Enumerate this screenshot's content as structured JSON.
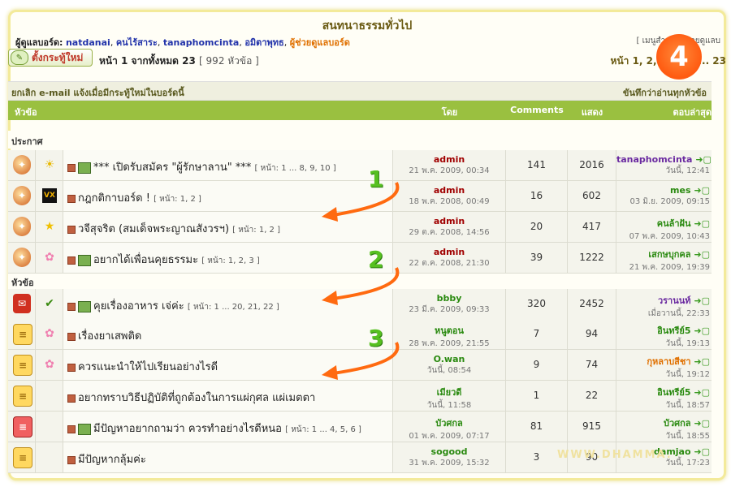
{
  "board": {
    "title": "สนทนาธรรมทั่วไป",
    "moderators_label": "ผู้ดูแลบอร์ด:",
    "moderators": [
      "natdanai",
      "คนไร้สาระ",
      "tanaphomcinta",
      "อมิตาพุทธ"
    ],
    "moderator_helper": "ผู้ช่วยดูแลบอร์ด",
    "help_text": "[ เมนูสำหรับผู้ช่วยดูแลบ"
  },
  "toolbar": {
    "new_topic_label": "ตั้งกระทู้ใหม่",
    "page_info": "หน้า 1 จากทั้งหมด 23",
    "topic_count": "[ 992 หัวข้อ ]",
    "pages": "หน้า 1, 2, 3, 4, 5 ... 23"
  },
  "notify": {
    "left": "ยกเลิก e-mail แจ้งเมื่อมีกระทู้ใหม่ในบอร์ดนี้",
    "right": "ขันทึกว่าอ่านทุกหัวข้อ"
  },
  "headers": {
    "subject": "หัวข้อ",
    "by": "โดย",
    "comments": "Comments",
    "views": "แสดง",
    "last_post": "ตอบล่าสุด"
  },
  "sections": {
    "announcements": "ประกาศ",
    "topics": "หัวข้อ"
  },
  "rows": [
    {
      "status": "announce",
      "icon": "sun",
      "picture": true,
      "title": "*** เปิดรับสมัคร \"ผู้รักษาลาน\" ***",
      "pages": "[ หน้า: 1 ... 8, 9, 10 ]",
      "by": "admin",
      "by_color": "#a00000",
      "date": "21 พ.ค. 2009, 00:34",
      "comments": "141",
      "views": "2016",
      "last_by": "tanaphomcinta",
      "last_color": "#6a2aa0",
      "last_date": "วันนี้, 12:41"
    },
    {
      "status": "announce",
      "icon": "vx",
      "picture": false,
      "title": "กฎกติกาบอร์ด !",
      "pages": "[ หน้า: 1, 2 ]",
      "by": "admin",
      "by_color": "#a00000",
      "date": "18 พ.ค. 2008, 00:49",
      "comments": "16",
      "views": "602",
      "last_by": "mes",
      "last_color": "#2a8a10",
      "last_date": "03 มิ.ย. 2009, 09:15"
    },
    {
      "status": "announce",
      "icon": "star",
      "picture": false,
      "title": "วจีสุจริต (สมเด็จพระญาณสังวรฯ)",
      "pages": "[ หน้า: 1, 2 ]",
      "by": "admin",
      "by_color": "#a00000",
      "date": "29 ต.ค. 2008, 14:56",
      "comments": "20",
      "views": "417",
      "last_by": "คนล้าฝัน",
      "last_color": "#2a8a10",
      "last_date": "07 พ.ค. 2009, 10:43"
    },
    {
      "status": "announce",
      "icon": "flower",
      "picture": true,
      "title": "อยากได้เพื่อนคุยธรรมะ",
      "pages": "[ หน้า: 1, 2, 3 ]",
      "by": "admin",
      "by_color": "#a00000",
      "date": "22 ต.ค. 2008, 21:30",
      "comments": "39",
      "views": "1222",
      "last_by": "เสกษบุกคล",
      "last_color": "#2a8a10",
      "last_date": "21 พ.ค. 2009, 19:39"
    },
    {
      "status": "hot",
      "icon": "check",
      "picture": true,
      "title": "คุยเรื่องอาหาร เจ่ค่ะ",
      "pages": "[ หน้า: 1 ... 20, 21, 22 ]",
      "by": "bbby",
      "by_color": "#2a8a10",
      "date": "23 มี.ค. 2009, 09:33",
      "comments": "320",
      "views": "2452",
      "last_by": "วรานนท์",
      "last_color": "#6a2aa0",
      "last_date": "เมื่อวานนี้, 22:33"
    },
    {
      "status": "normal",
      "icon": "flower",
      "picture": false,
      "title": "เรื่องยาเสพติด",
      "pages": "",
      "by": "หนูตอน",
      "by_color": "#2a8a10",
      "date": "28 พ.ค. 2009, 21:55",
      "comments": "7",
      "views": "94",
      "last_by": "อินทรีย์5",
      "last_color": "#2a8a10",
      "last_date": "วันนี้, 19:13"
    },
    {
      "status": "normal",
      "icon": "flower",
      "picture": false,
      "title": "ควรแนะนำให้ไปเรียนอย่างไรดี",
      "pages": "",
      "by": "O.wan",
      "by_color": "#2a8a10",
      "date": "วันนี้, 08:54",
      "comments": "9",
      "views": "74",
      "last_by": "กุหลาบสีชา",
      "last_color": "#e07000",
      "last_date": "วันนี้, 19:12"
    },
    {
      "status": "normal",
      "icon": "",
      "picture": false,
      "title": "อยากทราบวิธีปฏิบัติที่ถูกต้องในการแผ่กุศล แผ่เมตตา",
      "pages": "",
      "by": "เมียวดี",
      "by_color": "#2a8a10",
      "date": "วันนี้, 11:58",
      "comments": "1",
      "views": "22",
      "last_by": "อินทรีย์5",
      "last_color": "#2a8a10",
      "last_date": "วันนี้, 18:57"
    },
    {
      "status": "hotdoc",
      "icon": "",
      "picture": true,
      "title": "มีปัญหาอยากถามว่า ควรทำอย่างไรดีหนอ",
      "pages": "[ หน้า: 1 ... 4, 5, 6 ]",
      "by": "บัวศกล",
      "by_color": "#2a8a10",
      "date": "01 พ.ค. 2009, 07:17",
      "comments": "81",
      "views": "915",
      "last_by": "บัวศกล",
      "last_color": "#2a8a10",
      "last_date": "วันนี้, 18:55"
    },
    {
      "status": "normal",
      "icon": "",
      "picture": false,
      "title": "มีปัญหากลุ้มค่ะ",
      "pages": "",
      "by": "sogood",
      "by_color": "#2a8a10",
      "date": "31 พ.ค. 2009, 15:32",
      "comments": "3",
      "views": "90",
      "last_by": "damjao",
      "last_color": "#2a8a10",
      "last_date": "วันนี้, 17:23"
    }
  ],
  "annotations": [
    "1",
    "2",
    "3"
  ],
  "badge": "4",
  "watermark": "WWW.DHAMMA.",
  "colors": {
    "header_green": "#9ac040",
    "arrow_orange": "#ff6a10",
    "annotation_green": "#56c020",
    "frame_yellow": "#f3ea9a"
  }
}
